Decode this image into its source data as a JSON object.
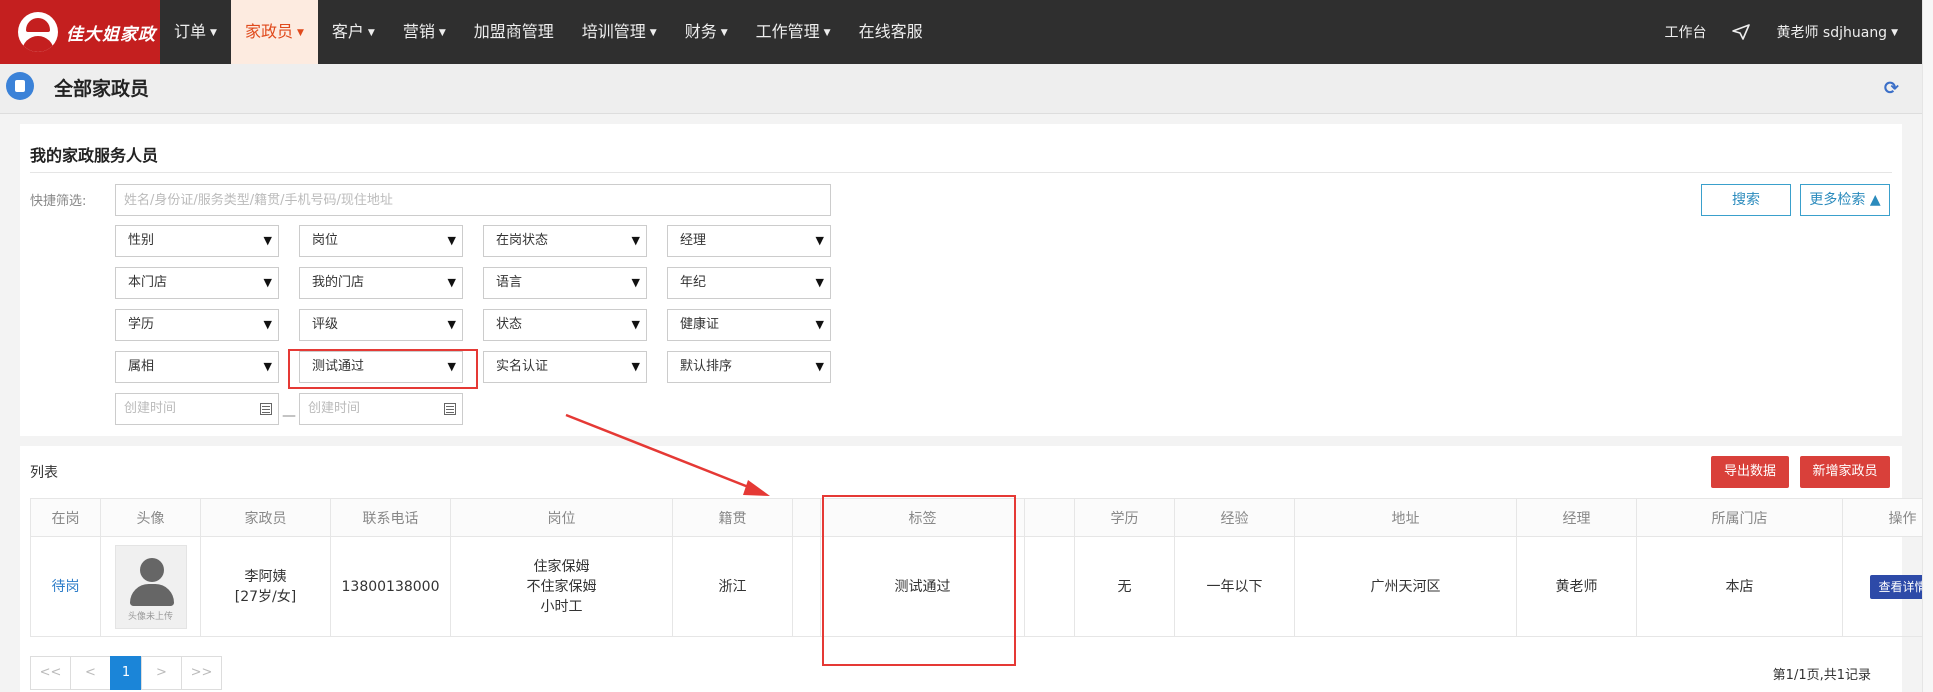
{
  "topnav": {
    "logo_text": "佳大姐家政",
    "items": [
      {
        "label": "订单",
        "caret": true
      },
      {
        "label": "家政员",
        "caret": true,
        "active": true
      },
      {
        "label": "客户",
        "caret": true
      },
      {
        "label": "营销",
        "caret": true
      },
      {
        "label": "加盟商管理",
        "caret": false
      },
      {
        "label": "培训管理",
        "caret": true
      },
      {
        "label": "财务",
        "caret": true
      },
      {
        "label": "工作管理",
        "caret": true
      },
      {
        "label": "在线客服",
        "caret": false
      }
    ],
    "workbench": "工作台",
    "user": "黄老师  sdjhuang",
    "active_color": "#e04a1c",
    "brand_color": "#c41f1f"
  },
  "page": {
    "title": "全部家政员"
  },
  "filters": {
    "title": "我的家政服务人员",
    "quick_label": "快捷筛选:",
    "search_placeholder": "姓名/身份证/服务类型/籍贯/手机号码/现住地址",
    "search_button": "搜索",
    "more_button": "更多检索",
    "selects": [
      [
        "性别",
        "岗位",
        "在岗状态",
        "经理"
      ],
      [
        "本门店",
        "我的门店",
        "语言",
        "年纪"
      ],
      [
        "学历",
        "评级",
        "状态",
        "健康证"
      ],
      [
        "属相",
        "测试通过",
        "实名认证",
        "默认排序"
      ]
    ],
    "date_from_placeholder": "创建时间",
    "date_to_placeholder": "创建时间",
    "date_sep": "—"
  },
  "list": {
    "label": "列表",
    "export_button": "导出数据",
    "add_button": "新增家政员",
    "columns": [
      "在岗",
      "头像",
      "家政员",
      "联系电话",
      "岗位",
      "籍贯",
      "",
      "标签",
      "",
      "学历",
      "经验",
      "地址",
      "经理",
      "所属门店",
      "操作"
    ],
    "rows": [
      {
        "status": "待岗",
        "avatar_caption": "头像未上传",
        "name": "李阿姨",
        "name_sub": "[27岁/女]",
        "phone": "13800138000",
        "positions": [
          "住家保姆",
          "不住家保姆",
          "小时工"
        ],
        "origin": "浙江",
        "tag": "测试通过",
        "education": "无",
        "experience": "一年以下",
        "address": "广州天河区",
        "manager": "黄老师",
        "store": "本店",
        "action": "查看详情"
      }
    ]
  },
  "pagination": {
    "first": "<<",
    "prev": "<",
    "current": "1",
    "next": ">",
    "last": ">>",
    "info": "第1/1页,共1记录"
  },
  "annotation_color": "#e53935"
}
